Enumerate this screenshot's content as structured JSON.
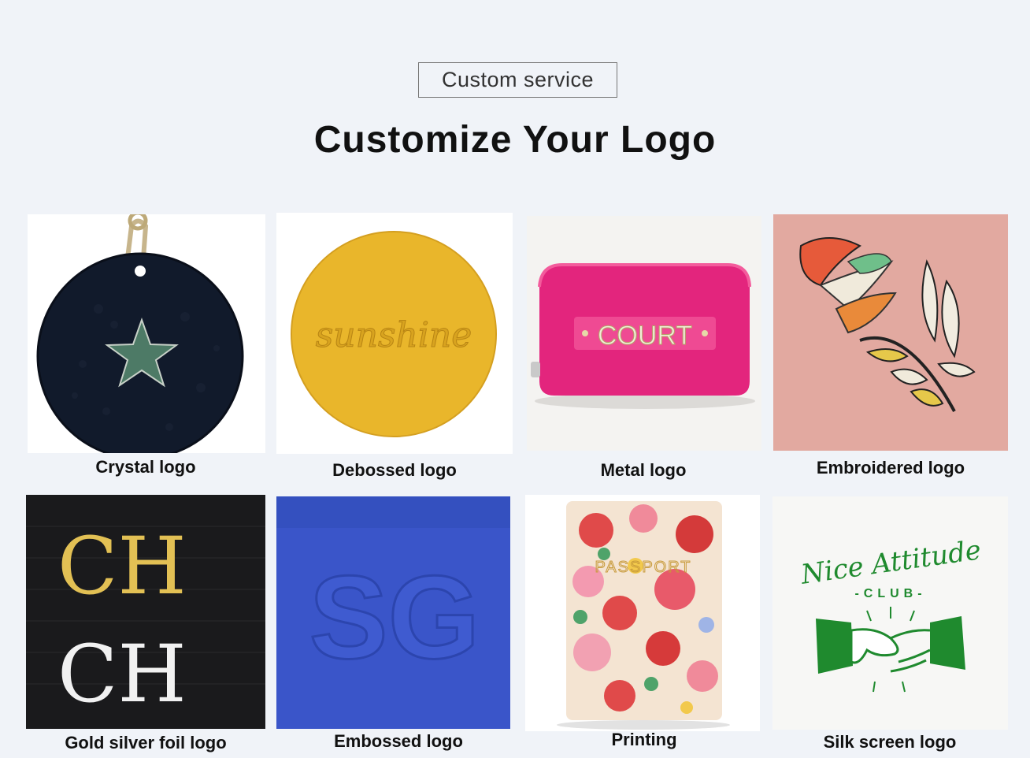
{
  "header": {
    "tag_label": "Custom service",
    "title": "Customize Your Logo"
  },
  "logos": [
    {
      "caption": "Crystal logo",
      "image": "black-leather-keychain-with-green-star"
    },
    {
      "caption": "Debossed logo",
      "image": "yellow-leather-circle-debossed-text",
      "text": "sunshine"
    },
    {
      "caption": "Metal logo",
      "image": "pink-pouch-with-metal-letters",
      "text": "COURT"
    },
    {
      "caption": "Embroidered logo",
      "image": "pink-leather-with-embroidered-flowers"
    },
    {
      "caption": "Gold silver foil logo",
      "image": "black-saffiano-with-foil-initials",
      "line1": "CH",
      "line2": "CH"
    },
    {
      "caption": "Embossed logo",
      "image": "blue-leather-embossed-initials",
      "text": "SG"
    },
    {
      "caption": "Printing",
      "image": "floral-printed-passport-cover",
      "text": "PASSPORT"
    },
    {
      "caption": "Silk screen logo",
      "image": "white-leather-green-print",
      "line1": "Nice Attitude",
      "line2": "-CLUB-"
    }
  ],
  "colors": {
    "background": "#f0f3f8",
    "crystal_leather": "#111a2b",
    "star_green": "#4d7a66",
    "debossed_yellow": "#e9b62b",
    "metal_pink": "#e3257d",
    "embroidery_pink": "#e2a9a0",
    "foil_gold": "#e2c054",
    "embossed_blue": "#3a55c9",
    "silkscreen_green": "#1f8a2e"
  }
}
